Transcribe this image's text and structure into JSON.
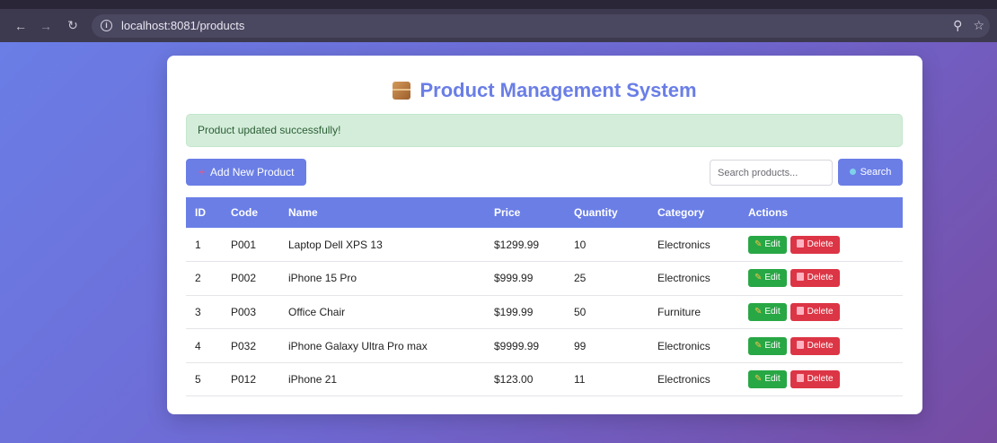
{
  "browser": {
    "url": "localhost:8081/products",
    "icons": {
      "back": "arrow-left-icon",
      "forward": "arrow-right-icon",
      "reload": "reload-icon",
      "info": "info-icon",
      "zoom": "zoom-icon",
      "bookmark": "star-icon"
    }
  },
  "header": {
    "title": "Product Management System",
    "icon": "package-icon"
  },
  "alert": {
    "message": "Product updated successfully!"
  },
  "toolbar": {
    "add_label": "Add New Product",
    "search_placeholder": "Search products...",
    "search_label": "Search"
  },
  "table": {
    "columns": [
      "ID",
      "Code",
      "Name",
      "Price",
      "Quantity",
      "Category",
      "Actions"
    ],
    "rows": [
      {
        "id": "1",
        "code": "P001",
        "name": "Laptop Dell XPS 13",
        "price": "$1299.99",
        "quantity": "10",
        "category": "Electronics"
      },
      {
        "id": "2",
        "code": "P002",
        "name": "iPhone 15 Pro",
        "price": "$999.99",
        "quantity": "25",
        "category": "Electronics"
      },
      {
        "id": "3",
        "code": "P003",
        "name": "Office Chair",
        "price": "$199.99",
        "quantity": "50",
        "category": "Furniture"
      },
      {
        "id": "4",
        "code": "P032",
        "name": "iPhone Galaxy Ultra Pro max",
        "price": "$9999.99",
        "quantity": "99",
        "category": "Electronics"
      },
      {
        "id": "5",
        "code": "P012",
        "name": "iPhone 21",
        "price": "$123.00",
        "quantity": "11",
        "category": "Electronics"
      }
    ],
    "edit_label": "Edit",
    "delete_label": "Delete"
  },
  "colors": {
    "primary": "#6a7ee6",
    "success": "#28a745",
    "danger": "#dc3545",
    "alert_bg": "#d4edda"
  }
}
